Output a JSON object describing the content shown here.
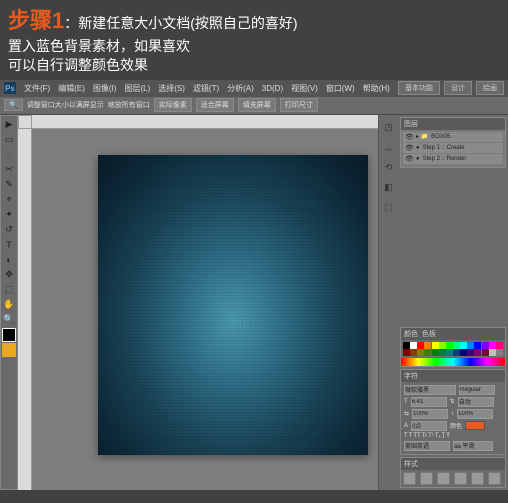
{
  "banner": {
    "step": "步骤1",
    "line1_rest": "：新建任意大小文档(按照自己的喜好)",
    "line2": "置入蓝色背景素材，如果喜欢",
    "line3": "可以自行调整颜色效果"
  },
  "menu": {
    "items": [
      "文件(F)",
      "编辑(E)",
      "图像(I)",
      "图层(L)",
      "选择(S)",
      "滤镜(T)",
      "分析(A)",
      "3D(D)",
      "视图(V)",
      "窗口(W)",
      "帮助(H)"
    ],
    "right": [
      "基本功能",
      "设计",
      "绘画"
    ]
  },
  "optbar": {
    "items": [
      "调整窗口大小以满屏显示",
      "缩放所有窗口",
      "实际像素",
      "适合屏幕",
      "填充屏幕",
      "打印尺寸"
    ]
  },
  "tools": [
    "▶",
    "▭",
    "◌",
    "✂",
    "✎",
    "⌖",
    "✦",
    "↺",
    "T",
    "◐",
    "✥",
    "⬚",
    "⊕",
    "✋",
    "🔍"
  ],
  "dock": [
    "◳",
    "↔",
    "⟲",
    "◧",
    "⬚",
    "≡"
  ],
  "panels": {
    "layers": {
      "tabs": [
        "图层"
      ],
      "group": "BOX05",
      "rows": [
        {
          "icon": "●",
          "label": "Step 1 :: Create"
        },
        {
          "icon": "●",
          "label": "Step 2 :: Render"
        }
      ]
    },
    "color": {
      "tabs": [
        "颜色",
        "色板"
      ]
    },
    "char": {
      "tabs": [
        "字符"
      ],
      "font": "微软雅黑",
      "style": "Regular",
      "size": "6.41",
      "leading": "自动",
      "tracking": "100%",
      "scale": "100%",
      "baseline": "0点",
      "color_label": "颜色",
      "lang": "美国英语",
      "aa": "aa 平滑"
    },
    "styles": {
      "tabs": [
        "样式"
      ]
    }
  },
  "swatches": [
    "#000",
    "#fff",
    "#f00",
    "#ff8000",
    "#ff0",
    "#80ff00",
    "#0f0",
    "#00ff80",
    "#0ff",
    "#0080ff",
    "#00f",
    "#8000ff",
    "#f0f",
    "#ff0080",
    "#800000",
    "#804000",
    "#808000",
    "#408000",
    "#008000",
    "#008040",
    "#008080",
    "#004080",
    "#000080",
    "#400080",
    "#800080",
    "#800040",
    "#c0c0c0",
    "#808080"
  ]
}
